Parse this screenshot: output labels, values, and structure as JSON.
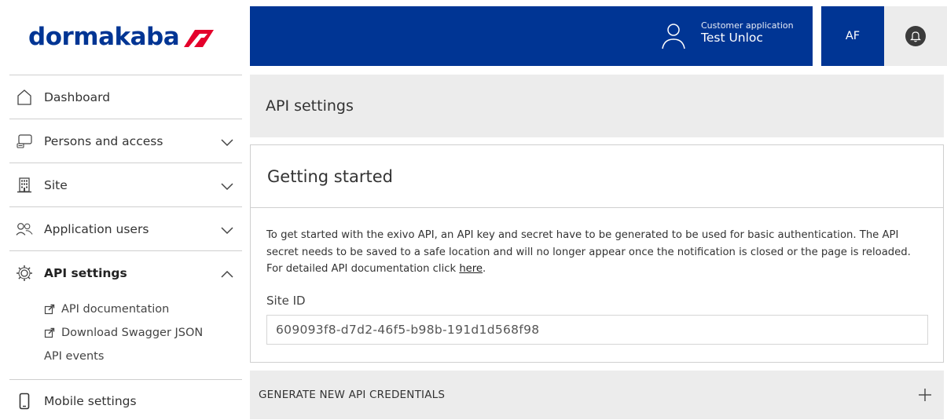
{
  "logo": {
    "text": "dormakaba"
  },
  "header": {
    "app_label": "Customer application",
    "app_name": "Test Unloc",
    "avatar_initials": "AF"
  },
  "sidebar": {
    "items": [
      {
        "label": "Dashboard",
        "icon": "home-icon"
      },
      {
        "label": "Persons and access",
        "icon": "persons-access-icon"
      },
      {
        "label": "Site",
        "icon": "building-icon"
      },
      {
        "label": "Application users",
        "icon": "users-icon"
      },
      {
        "label": "API settings",
        "icon": "gear-icon"
      },
      {
        "label": "Mobile settings",
        "icon": "mobile-icon"
      }
    ],
    "sub_items": [
      {
        "label": "API documentation",
        "icon": "external-link-icon"
      },
      {
        "label": "Download Swagger JSON",
        "icon": "external-link-icon"
      },
      {
        "label": "API events"
      }
    ]
  },
  "main": {
    "page_title": "API settings",
    "card_title": "Getting started",
    "description": "To get started with the exivo API, an API key and secret have to be generated to be used for basic authentication. The API secret needs to be saved to a safe location and will no longer appear once the notification is closed or the page is reloaded. For detailed API documentation click ",
    "description_link": "here",
    "description_end": ".",
    "site_id_label": "Site ID",
    "site_id_value": "609093f8-d7d2-46f5-b98b-191d1d568f98",
    "generate_label": "GENERATE NEW API CREDENTIALS"
  },
  "colors": {
    "brand_blue": "#003594",
    "panel_grey": "#ececec",
    "logo_red": "#e4002b"
  }
}
